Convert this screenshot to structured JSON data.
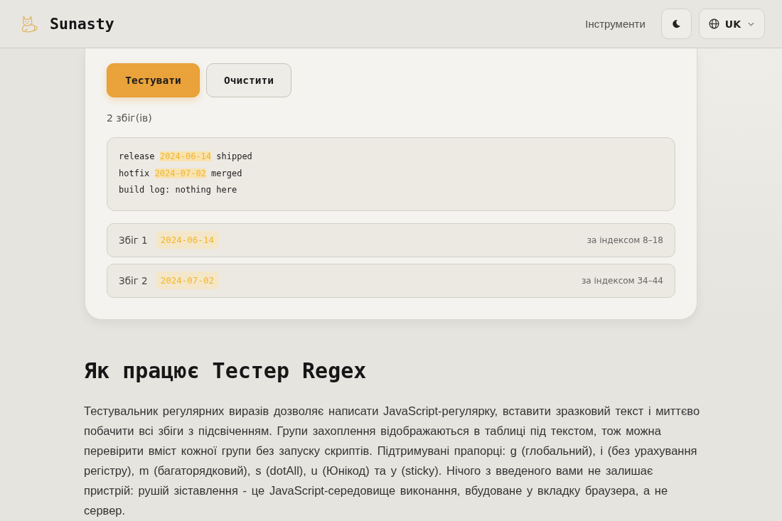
{
  "header": {
    "brand": "Sunasty",
    "nav_link": "Інструменти",
    "language": "UK"
  },
  "actions": [
    {
      "label": "Тестувати",
      "kind": "primary"
    },
    {
      "label": "Очистити",
      "kind": "secondary"
    }
  ],
  "match_count": "2 збіг(ів)",
  "test_text": {
    "lines": [
      {
        "segments": [
          {
            "text": "release ",
            "highlighted": false
          },
          {
            "text": "2024-06-14",
            "highlighted": true
          },
          {
            "text": " shipped",
            "highlighted": false
          }
        ]
      },
      {
        "segments": [
          {
            "text": "hotfix ",
            "highlighted": false
          },
          {
            "text": "2024-07-02",
            "highlighted": true
          },
          {
            "text": " merged",
            "highlighted": false
          }
        ]
      },
      {
        "segments": [
          {
            "text": "build log: nothing here",
            "highlighted": false
          }
        ]
      }
    ]
  },
  "matches": [
    {
      "label": "Збіг 1",
      "value": "2024-06-14",
      "position": "за індексом 8–18"
    },
    {
      "label": "Збіг 2",
      "value": "2024-07-02",
      "position": "за індексом 34–44"
    }
  ],
  "article": {
    "heading": "Як працює Тестер Regex",
    "paragraph": "Тестувальник регулярних виразів дозволяє написати JavaScript-регулярку, вставити зразковий текст і миттєво побачити всі збіги з підсвіченням. Групи захоплення відображаються в таблиці під текстом, тож можна перевірити вміст кожної групи без запуску скриптів. Підтримувані прапорці: g (глобальний), i (без урахування регістру), m (багаторядковий), s (dotAll), u (Юнікод) та y (sticky). Нічого з введеного вами не залишає пристрій: рушій зіставлення - це JavaScript-середовище виконання, вбудоване у вкладку браузера, а не сервер."
  }
}
